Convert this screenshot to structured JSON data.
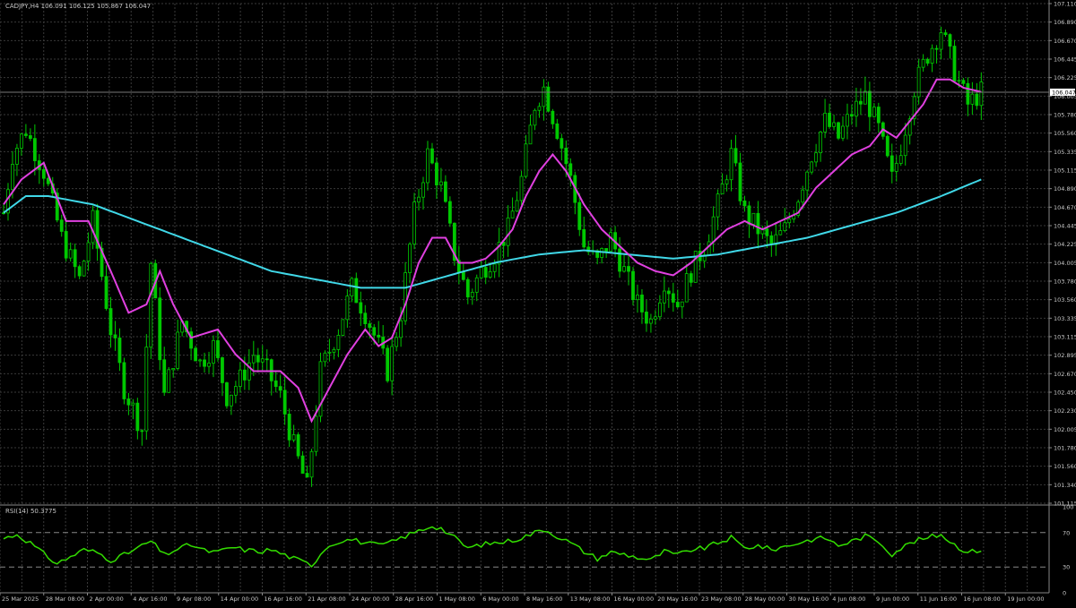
{
  "header": {
    "symbol_line": "CADJPY,H4  106.091 106.125 105.867 106.047",
    "current_price": "106.047"
  },
  "rsi_panel": {
    "label": "RSI(14) 50.3775",
    "levels": [
      30,
      70
    ],
    "ticks": [
      "100",
      "70",
      "30",
      "0"
    ]
  },
  "colors": {
    "background": "#000000",
    "grid": "#3a3a3a",
    "candle": "#00c800",
    "ma_fast": "#e040e0",
    "ma_slow": "#40d8e8",
    "rsi_line": "#33dd00",
    "text": "#c8c8c8",
    "price_tag_bg": "#ffffff"
  },
  "chart_data": [
    {
      "type": "candlestick",
      "title": "CADJPY,H4",
      "ylim": [
        101.115,
        107.11
      ],
      "y_ticks": [
        "107.110",
        "106.890",
        "106.670",
        "106.445",
        "106.225",
        "106.005",
        "105.780",
        "105.560",
        "105.335",
        "105.115",
        "104.890",
        "104.670",
        "104.445",
        "104.225",
        "104.005",
        "103.780",
        "103.560",
        "103.335",
        "103.115",
        "102.895",
        "102.670",
        "102.450",
        "102.230",
        "102.005",
        "101.780",
        "101.560",
        "101.340",
        "101.115"
      ],
      "x_ticks": [
        "25 Mar 2025",
        "28 Mar 08:00",
        "2 Apr 00:00",
        "4 Apr 16:00",
        "9 Apr 08:00",
        "14 Apr 00:00",
        "16 Apr 16:00",
        "21 Apr 08:00",
        "24 Apr 00:00",
        "28 Apr 16:00",
        "1 May 08:00",
        "6 May 00:00",
        "8 May 16:00",
        "13 May 08:00",
        "16 May 00:00",
        "20 May 16:00",
        "23 May 08:00",
        "28 May 00:00",
        "30 May 16:00",
        "4 Jun 08:00",
        "9 Jun 00:00",
        "11 Jun 16:00",
        "16 Jun 08:00",
        "19 Jun 00:00"
      ],
      "last_price": 106.047,
      "close_path": [
        [
          0,
          104.6
        ],
        [
          2,
          105.3
        ],
        [
          5,
          105.6
        ],
        [
          9,
          105.1
        ],
        [
          13,
          104.3
        ],
        [
          17,
          103.8
        ],
        [
          20,
          104.5
        ],
        [
          24,
          103.2
        ],
        [
          27,
          102.5
        ],
        [
          31,
          102.0
        ],
        [
          33,
          104.0
        ],
        [
          36,
          102.4
        ],
        [
          40,
          103.3
        ],
        [
          44,
          102.8
        ],
        [
          47,
          103.0
        ],
        [
          50,
          102.4
        ],
        [
          53,
          102.6
        ],
        [
          56,
          102.9
        ],
        [
          59,
          102.7
        ],
        [
          62,
          102.4
        ],
        [
          65,
          101.8
        ],
        [
          68,
          101.3
        ],
        [
          71,
          102.7
        ],
        [
          75,
          103.2
        ],
        [
          78,
          103.7
        ],
        [
          81,
          103.4
        ],
        [
          84,
          103.0
        ],
        [
          86,
          102.7
        ],
        [
          89,
          103.4
        ],
        [
          92,
          104.6
        ],
        [
          95,
          105.3
        ],
        [
          98,
          104.9
        ],
        [
          101,
          104.1
        ],
        [
          104,
          103.6
        ],
        [
          107,
          103.9
        ],
        [
          110,
          104.1
        ],
        [
          113,
          104.4
        ],
        [
          116,
          105.0
        ],
        [
          119,
          105.9
        ],
        [
          121,
          106.1
        ],
        [
          124,
          105.6
        ],
        [
          127,
          105.0
        ],
        [
          130,
          104.2
        ],
        [
          133,
          104.0
        ],
        [
          136,
          104.3
        ],
        [
          139,
          103.9
        ],
        [
          142,
          103.5
        ],
        [
          145,
          103.3
        ],
        [
          148,
          103.8
        ],
        [
          151,
          103.5
        ],
        [
          154,
          103.9
        ],
        [
          157,
          104.2
        ],
        [
          160,
          104.7
        ],
        [
          163,
          105.3
        ],
        [
          166,
          104.6
        ],
        [
          169,
          104.4
        ],
        [
          172,
          104.2
        ],
        [
          175,
          104.4
        ],
        [
          178,
          104.8
        ],
        [
          181,
          105.3
        ],
        [
          184,
          105.7
        ],
        [
          187,
          105.5
        ],
        [
          190,
          105.8
        ],
        [
          193,
          106.0
        ],
        [
          196,
          105.6
        ],
        [
          199,
          105.0
        ],
        [
          201,
          105.4
        ],
        [
          204,
          106.1
        ],
        [
          207,
          106.5
        ],
        [
          210,
          106.8
        ],
        [
          213,
          106.3
        ],
        [
          216,
          105.9
        ],
        [
          219,
          106.05
        ]
      ],
      "ma_fast_path": [
        [
          0,
          104.7
        ],
        [
          4,
          105.0
        ],
        [
          9,
          105.2
        ],
        [
          14,
          104.5
        ],
        [
          19,
          104.5
        ],
        [
          24,
          103.9
        ],
        [
          28,
          103.4
        ],
        [
          32,
          103.5
        ],
        [
          35,
          103.9
        ],
        [
          38,
          103.5
        ],
        [
          42,
          103.1
        ],
        [
          48,
          103.2
        ],
        [
          52,
          102.9
        ],
        [
          56,
          102.7
        ],
        [
          62,
          102.7
        ],
        [
          66,
          102.5
        ],
        [
          69,
          102.1
        ],
        [
          73,
          102.5
        ],
        [
          77,
          102.9
        ],
        [
          81,
          103.2
        ],
        [
          84,
          103.0
        ],
        [
          87,
          103.1
        ],
        [
          90,
          103.5
        ],
        [
          93,
          104.0
        ],
        [
          96,
          104.3
        ],
        [
          99,
          104.3
        ],
        [
          102,
          104.0
        ],
        [
          105,
          104.0
        ],
        [
          108,
          104.05
        ],
        [
          111,
          104.2
        ],
        [
          114,
          104.4
        ],
        [
          117,
          104.8
        ],
        [
          120,
          105.1
        ],
        [
          123,
          105.3
        ],
        [
          126,
          105.1
        ],
        [
          130,
          104.7
        ],
        [
          134,
          104.4
        ],
        [
          138,
          104.2
        ],
        [
          142,
          104.0
        ],
        [
          146,
          103.9
        ],
        [
          150,
          103.85
        ],
        [
          154,
          104.0
        ],
        [
          158,
          104.2
        ],
        [
          162,
          104.4
        ],
        [
          166,
          104.5
        ],
        [
          170,
          104.4
        ],
        [
          174,
          104.5
        ],
        [
          178,
          104.6
        ],
        [
          182,
          104.9
        ],
        [
          186,
          105.1
        ],
        [
          190,
          105.3
        ],
        [
          194,
          105.4
        ],
        [
          197,
          105.6
        ],
        [
          200,
          105.5
        ],
        [
          203,
          105.7
        ],
        [
          206,
          105.9
        ],
        [
          209,
          106.2
        ],
        [
          212,
          106.2
        ],
        [
          215,
          106.1
        ],
        [
          219,
          106.05
        ]
      ],
      "ma_slow_path": [
        [
          0,
          104.6
        ],
        [
          5,
          104.8
        ],
        [
          10,
          104.8
        ],
        [
          20,
          104.7
        ],
        [
          30,
          104.5
        ],
        [
          40,
          104.3
        ],
        [
          50,
          104.1
        ],
        [
          60,
          103.9
        ],
        [
          70,
          103.8
        ],
        [
          80,
          103.7
        ],
        [
          90,
          103.7
        ],
        [
          100,
          103.85
        ],
        [
          110,
          104.0
        ],
        [
          120,
          104.1
        ],
        [
          130,
          104.15
        ],
        [
          140,
          104.1
        ],
        [
          150,
          104.05
        ],
        [
          160,
          104.1
        ],
        [
          170,
          104.2
        ],
        [
          180,
          104.3
        ],
        [
          190,
          104.45
        ],
        [
          200,
          104.6
        ],
        [
          210,
          104.8
        ],
        [
          219,
          105.0
        ]
      ]
    },
    {
      "type": "line",
      "title": "RSI(14) 50.3775",
      "ylim": [
        0,
        100
      ],
      "levels": [
        30,
        70
      ],
      "values": [
        [
          0,
          63
        ],
        [
          3,
          68
        ],
        [
          6,
          58
        ],
        [
          9,
          45
        ],
        [
          12,
          34
        ],
        [
          15,
          42
        ],
        [
          18,
          50
        ],
        [
          21,
          47
        ],
        [
          24,
          38
        ],
        [
          27,
          44
        ],
        [
          30,
          52
        ],
        [
          33,
          60
        ],
        [
          36,
          44
        ],
        [
          39,
          51
        ],
        [
          42,
          56
        ],
        [
          45,
          49
        ],
        [
          48,
          47
        ],
        [
          51,
          53
        ],
        [
          54,
          50
        ],
        [
          57,
          48
        ],
        [
          60,
          50
        ],
        [
          63,
          44
        ],
        [
          66,
          38
        ],
        [
          69,
          32
        ],
        [
          72,
          52
        ],
        [
          75,
          60
        ],
        [
          78,
          62
        ],
        [
          81,
          58
        ],
        [
          84,
          55
        ],
        [
          87,
          59
        ],
        [
          90,
          66
        ],
        [
          93,
          72
        ],
        [
          96,
          78
        ],
        [
          98,
          75
        ],
        [
          101,
          64
        ],
        [
          104,
          52
        ],
        [
          107,
          56
        ],
        [
          110,
          58
        ],
        [
          113,
          60
        ],
        [
          116,
          64
        ],
        [
          119,
          70
        ],
        [
          121,
          74
        ],
        [
          124,
          66
        ],
        [
          127,
          58
        ],
        [
          130,
          48
        ],
        [
          133,
          40
        ],
        [
          136,
          47
        ],
        [
          139,
          45
        ],
        [
          142,
          41
        ],
        [
          145,
          38
        ],
        [
          148,
          48
        ],
        [
          151,
          44
        ],
        [
          154,
          50
        ],
        [
          157,
          52
        ],
        [
          160,
          58
        ],
        [
          163,
          64
        ],
        [
          166,
          52
        ],
        [
          169,
          55
        ],
        [
          172,
          50
        ],
        [
          175,
          54
        ],
        [
          178,
          58
        ],
        [
          181,
          62
        ],
        [
          184,
          64
        ],
        [
          187,
          55
        ],
        [
          190,
          60
        ],
        [
          193,
          66
        ],
        [
          196,
          60
        ],
        [
          199,
          45
        ],
        [
          201,
          52
        ],
        [
          204,
          60
        ],
        [
          207,
          64
        ],
        [
          210,
          68
        ],
        [
          213,
          56
        ],
        [
          216,
          47
        ],
        [
          219,
          50
        ]
      ]
    }
  ]
}
